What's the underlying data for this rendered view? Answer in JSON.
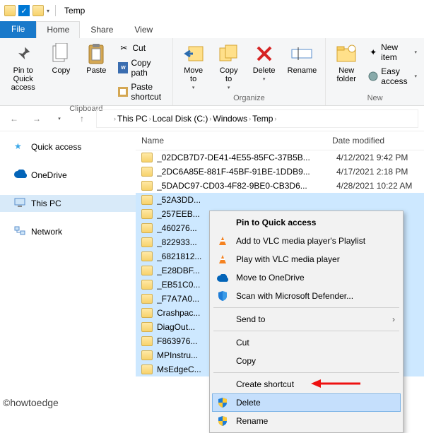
{
  "title": "Temp",
  "tabs": {
    "file": "File",
    "home": "Home",
    "share": "Share",
    "view": "View"
  },
  "ribbon": {
    "pin": "Pin to Quick\naccess",
    "copy": "Copy",
    "paste": "Paste",
    "cut": "Cut",
    "copypath": "Copy path",
    "pasteshort": "Paste shortcut",
    "clipboard": "Clipboard",
    "moveto": "Move\nto",
    "copyto": "Copy\nto",
    "delete": "Delete",
    "rename": "Rename",
    "organize": "Organize",
    "newfolder": "New\nfolder",
    "newitem": "New item",
    "easyaccess": "Easy access",
    "new": "New"
  },
  "breadcrumb": [
    "This PC",
    "Local Disk (C:)",
    "Windows",
    "Temp"
  ],
  "sidebar": {
    "quick": "Quick access",
    "onedrive": "OneDrive",
    "thispc": "This PC",
    "network": "Network"
  },
  "columns": {
    "name": "Name",
    "date": "Date modified"
  },
  "files": [
    {
      "name": "_02DCB7D7-DE41-4E55-85FC-37B5B...",
      "date": "4/12/2021 9:42 PM"
    },
    {
      "name": "_2DC6A85E-881F-45BF-91BE-1DDB9...",
      "date": "4/17/2021 2:18 PM"
    },
    {
      "name": "_5DADC97-CD03-4F82-9BE0-CB3D6...",
      "date": "4/28/2021 10:22 AM"
    },
    {
      "name": "_52A3DD...",
      "date": ""
    },
    {
      "name": "_257EEB...",
      "date": ""
    },
    {
      "name": "_460276...",
      "date": ""
    },
    {
      "name": "_822933...",
      "date": ""
    },
    {
      "name": "_6821812...",
      "date": ""
    },
    {
      "name": "_E28DBF...",
      "date": ""
    },
    {
      "name": "_EB51C0...",
      "date": ""
    },
    {
      "name": "_F7A7A0...",
      "date": ""
    },
    {
      "name": "Crashpac...",
      "date": ""
    },
    {
      "name": "DiagOut...",
      "date": ""
    },
    {
      "name": "F863976...",
      "date": ""
    },
    {
      "name": "MPInstru...",
      "date": ""
    },
    {
      "name": "MsEdgeC...",
      "date": ""
    }
  ],
  "ctx": {
    "pin": "Pin to Quick access",
    "addvlc": "Add to VLC media player's Playlist",
    "playvlc": "Play with VLC media player",
    "moveod": "Move to OneDrive",
    "scan": "Scan with Microsoft Defender...",
    "sendto": "Send to",
    "cut": "Cut",
    "copy": "Copy",
    "shortcut": "Create shortcut",
    "delete": "Delete",
    "rename": "Rename"
  },
  "watermark": "©howtoedge"
}
